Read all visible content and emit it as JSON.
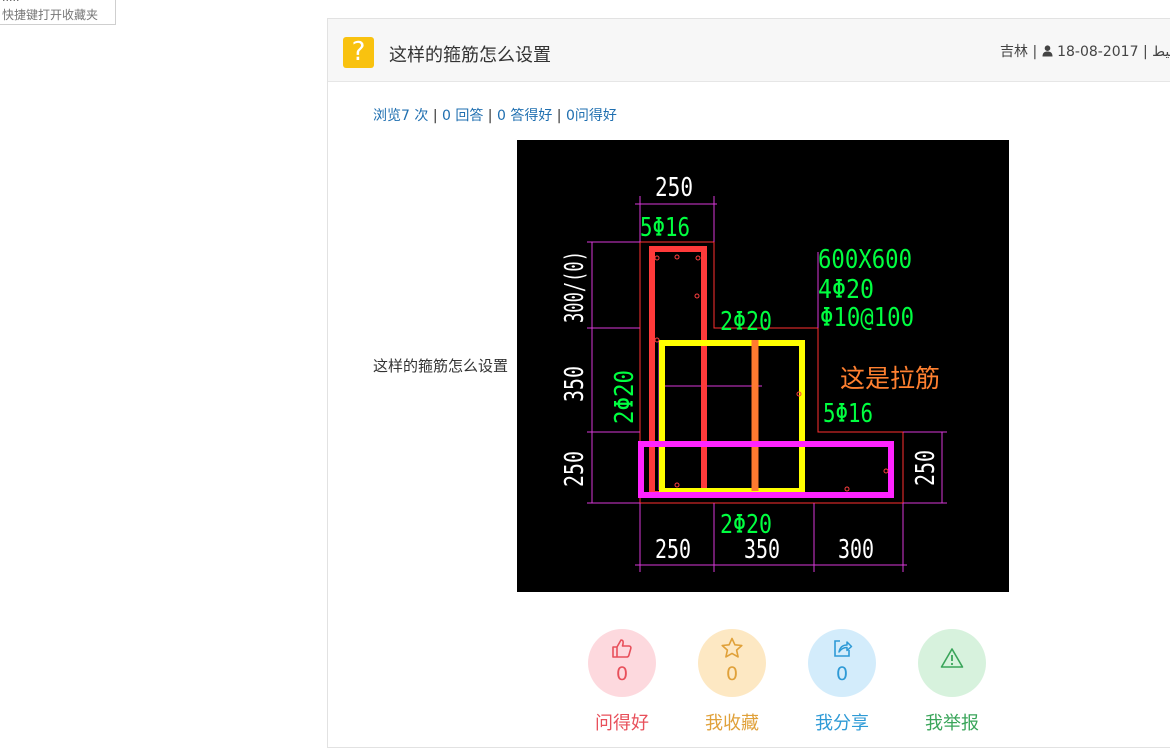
{
  "tooltip": {
    "text": "快捷键打开收藏夹"
  },
  "question": {
    "title": "这样的箍筋怎么设置",
    "location": "吉林",
    "username": "سيط",
    "date": "2017-08-18",
    "stats": {
      "views": "浏览7 次",
      "answers": "0 回答",
      "good_answers": "0 答得好",
      "good_questions": "0问得好"
    },
    "body_text": "这样的箍筋怎么设置"
  },
  "drawing": {
    "dim_top": "250",
    "rebar_top": "5Φ16",
    "col_size": "600X600",
    "col_rebar_1": "4Φ20",
    "col_rebar_2": "Φ10@100",
    "mid_rebar": "2Φ20",
    "annotation": "这是拉筋",
    "right_rebar": "5Φ16",
    "left_rebar": "2Φ20",
    "left_dim_1": "300/(0)",
    "left_dim_2": "350",
    "left_dim_3": "250",
    "right_dim": "250",
    "bottom_rebar": "2Φ20",
    "bottom_dim_1": "250",
    "bottom_dim_2": "350",
    "bottom_dim_3": "300"
  },
  "actions": [
    {
      "label": "问得好",
      "count": "0",
      "icon": "thumbs-up-icon",
      "color": "#e8505b",
      "bg": "#fdd9de"
    },
    {
      "label": "我收藏",
      "count": "0",
      "icon": "star-icon",
      "color": "#e0a13a",
      "bg": "#fde8c3"
    },
    {
      "label": "我分享",
      "count": "0",
      "icon": "share-icon",
      "color": "#2e9ad6",
      "bg": "#d3ecfb"
    },
    {
      "label": "我举报",
      "count": "",
      "icon": "warning-icon",
      "color": "#3aa55a",
      "bg": "#d7f2dd"
    }
  ]
}
